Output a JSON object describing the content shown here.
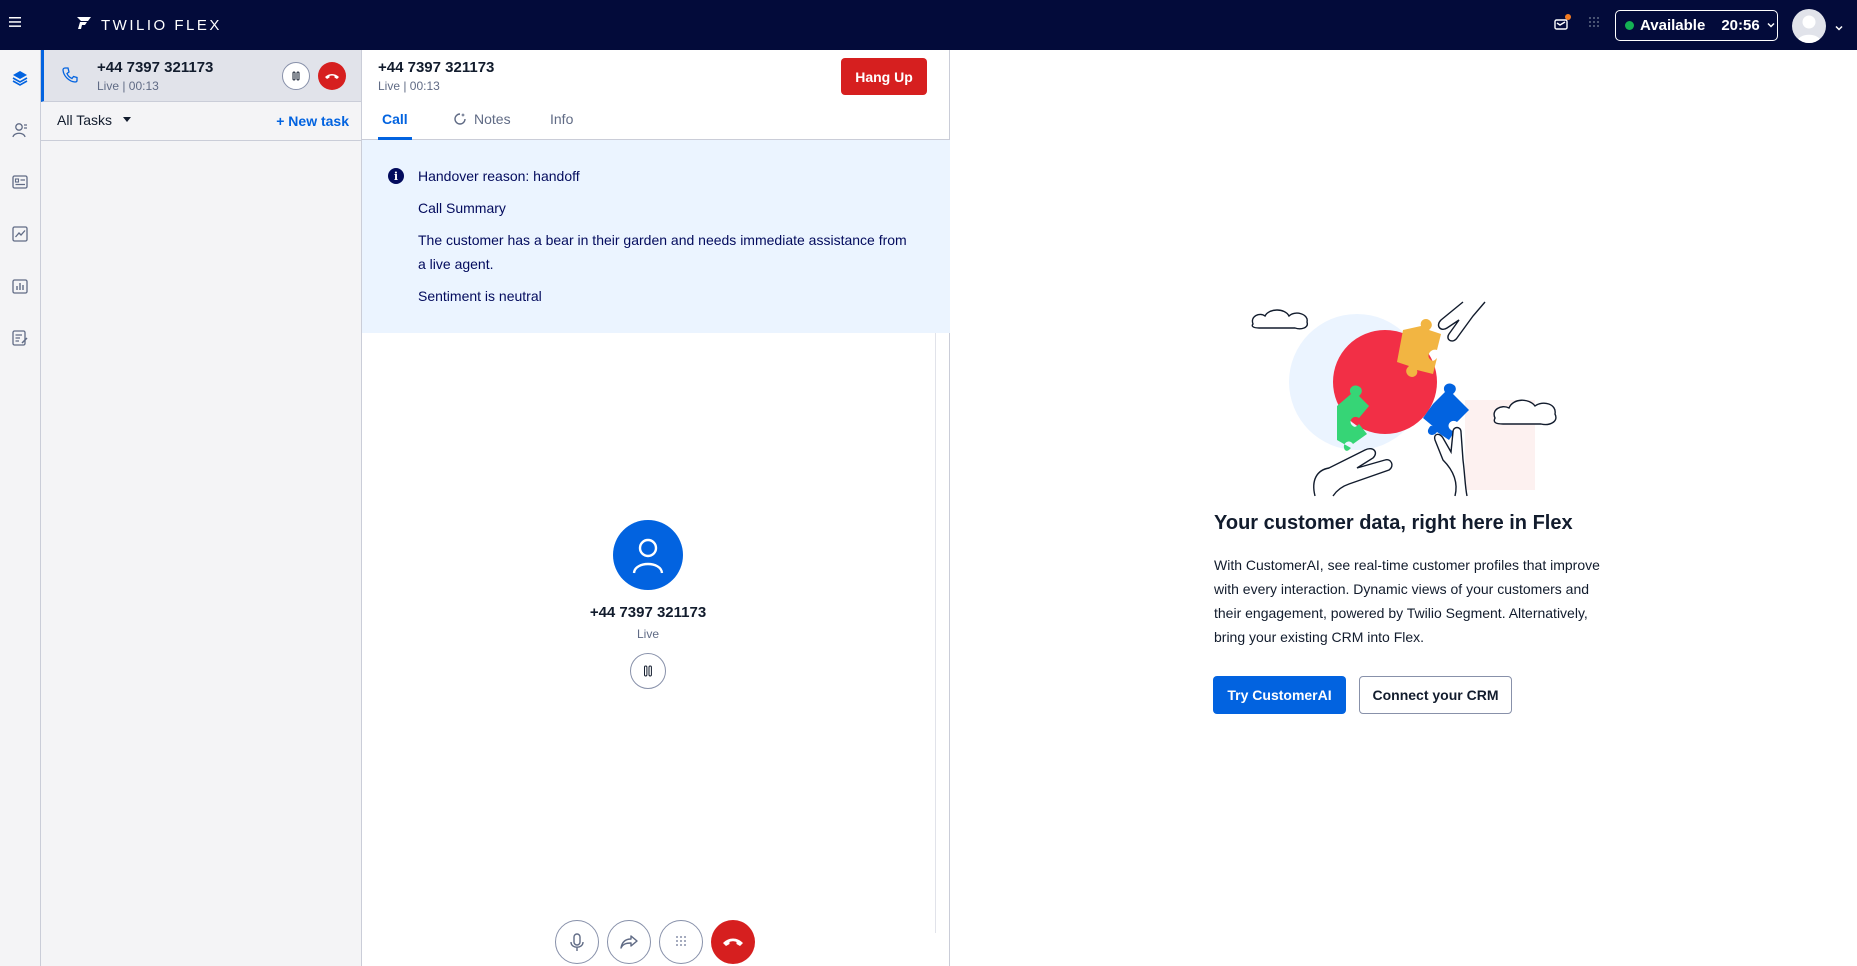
{
  "header": {
    "brand": "TWILIO FLEX",
    "status_label": "Available",
    "status_time": "20:56",
    "icons": [
      "menu-icon",
      "twilio-logo-icon",
      "notification-icon",
      "apps-grid-icon",
      "chevron-down-icon",
      "avatar"
    ]
  },
  "sidenav": {
    "items": [
      "layers-icon",
      "contacts-icon",
      "teams-icon",
      "analytics-icon",
      "dashboards-icon",
      "checklist-icon"
    ]
  },
  "tasklist": {
    "task": {
      "title": "+44 7397 321173",
      "status": "Live | 00:13"
    },
    "filter_label": "All Tasks",
    "new_task_label": "+ New task"
  },
  "call_panel": {
    "title": "+44 7397 321173",
    "subtitle": "Live | 00:13",
    "hangup_label": "Hang Up",
    "tabs": [
      {
        "label": "Call",
        "active": true
      },
      {
        "label": "Notes",
        "active": false
      },
      {
        "label": "Info",
        "active": false
      }
    ],
    "banner": {
      "reason": "Handover reason: handoff",
      "summary_heading": "Call Summary",
      "summary_text": "The customer has a bear in their garden and needs immediate assistance from a live agent.",
      "sentiment": "Sentiment is neutral"
    },
    "caller": {
      "number": "+44 7397 321173",
      "status": "Live"
    },
    "controls": [
      "microphone-icon",
      "transfer-icon",
      "dialpad-icon",
      "hangup-icon"
    ]
  },
  "crm": {
    "title": "Your customer data, right here in Flex",
    "description": "With CustomerAI, see real-time customer profiles that improve with every interaction. Dynamic views of your customers and their engagement, powered by Twilio Segment. Alternatively, bring your existing CRM into Flex.",
    "primary_button": "Try CustomerAI",
    "secondary_button": "Connect your CRM"
  },
  "colors": {
    "topbar": "#030b3a",
    "accent": "#0263e0",
    "danger": "#d61f1f",
    "banner_bg": "#ebf4ff",
    "available": "#14b053"
  }
}
